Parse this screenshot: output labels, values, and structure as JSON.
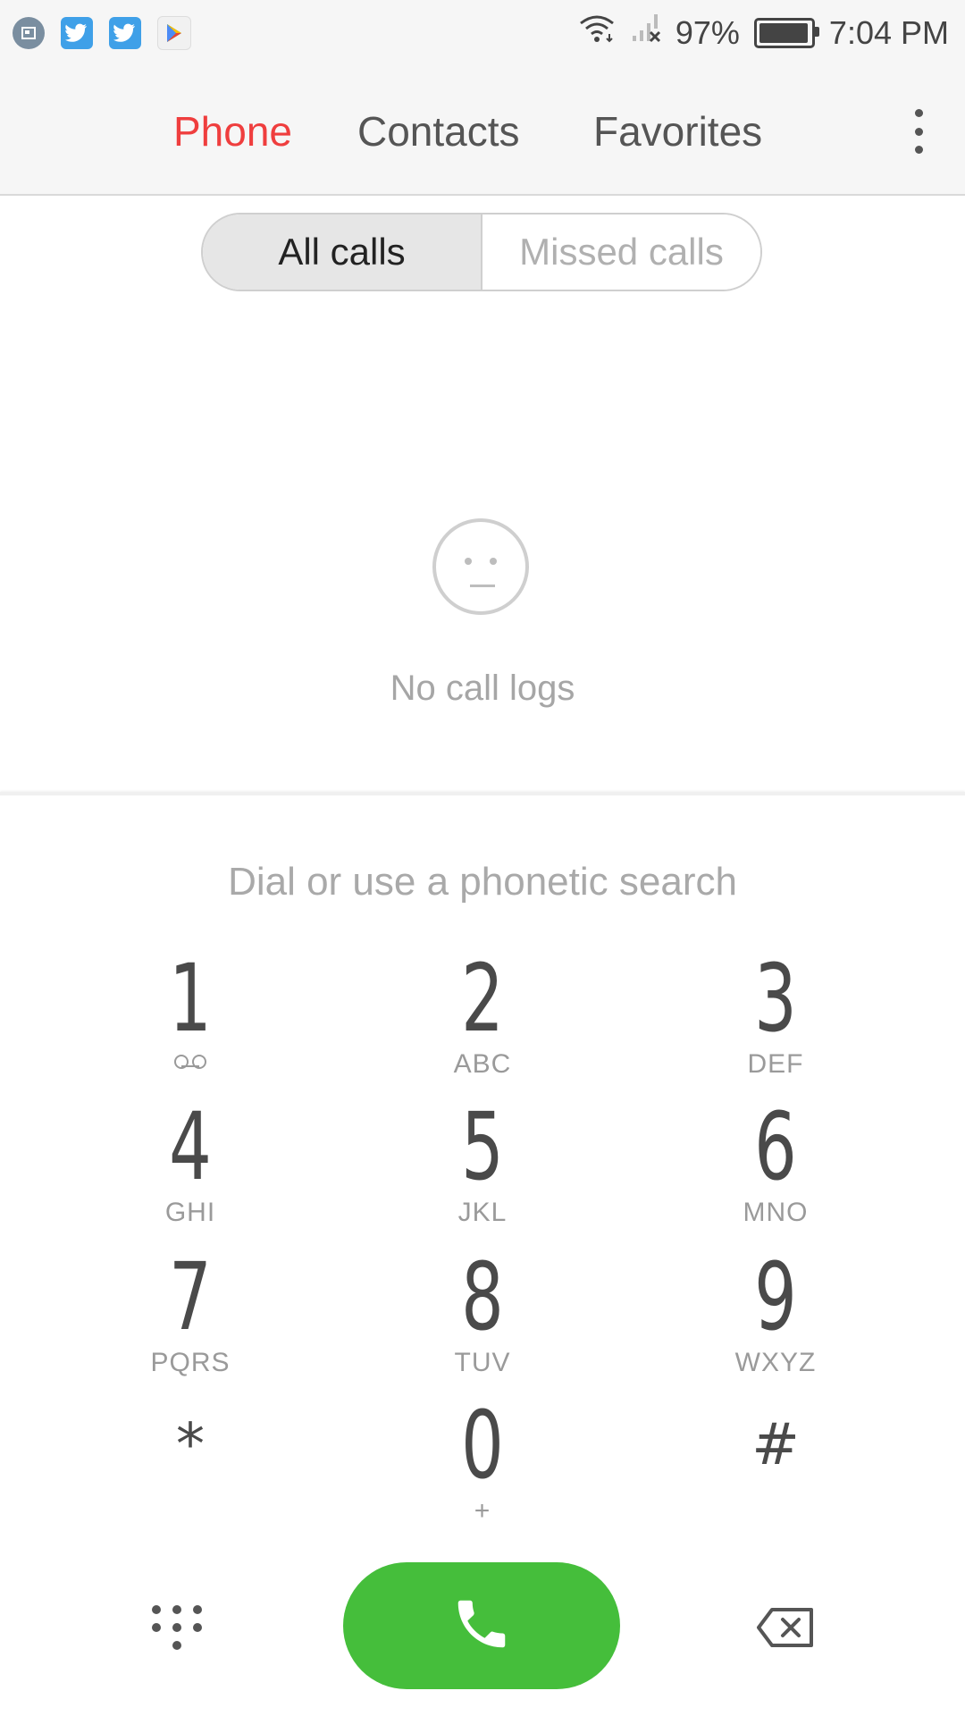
{
  "status_bar": {
    "notification_icons": [
      "screenshot-icon",
      "twitter-icon",
      "twitter-icon",
      "play-store-icon"
    ],
    "battery_percent": "97%",
    "battery_level": 0.97,
    "time": "7:04 PM"
  },
  "header": {
    "tabs": [
      {
        "label": "Phone",
        "active": true
      },
      {
        "label": "Contacts",
        "active": false
      },
      {
        "label": "Favorites",
        "active": false
      }
    ],
    "menu_icon": "more-vert-icon"
  },
  "filter": {
    "options": [
      {
        "label": "All calls",
        "selected": true
      },
      {
        "label": "Missed calls",
        "selected": false
      }
    ]
  },
  "empty_state": {
    "icon": "neutral-face-icon",
    "text": "No call logs"
  },
  "dialer": {
    "placeholder": "Dial or use a phonetic search",
    "keys": [
      {
        "digit": "1",
        "letters": ""
      },
      {
        "digit": "2",
        "letters": "ABC"
      },
      {
        "digit": "3",
        "letters": "DEF"
      },
      {
        "digit": "4",
        "letters": "GHI"
      },
      {
        "digit": "5",
        "letters": "JKL"
      },
      {
        "digit": "6",
        "letters": "MNO"
      },
      {
        "digit": "7",
        "letters": "PQRS"
      },
      {
        "digit": "8",
        "letters": "TUV"
      },
      {
        "digit": "9",
        "letters": "WXYZ"
      },
      {
        "digit": "*",
        "letters": ""
      },
      {
        "digit": "0",
        "letters": "+"
      },
      {
        "digit": "#",
        "letters": ""
      }
    ]
  },
  "colors": {
    "accent": "#ef3e3e",
    "call_button": "#45be3b"
  }
}
